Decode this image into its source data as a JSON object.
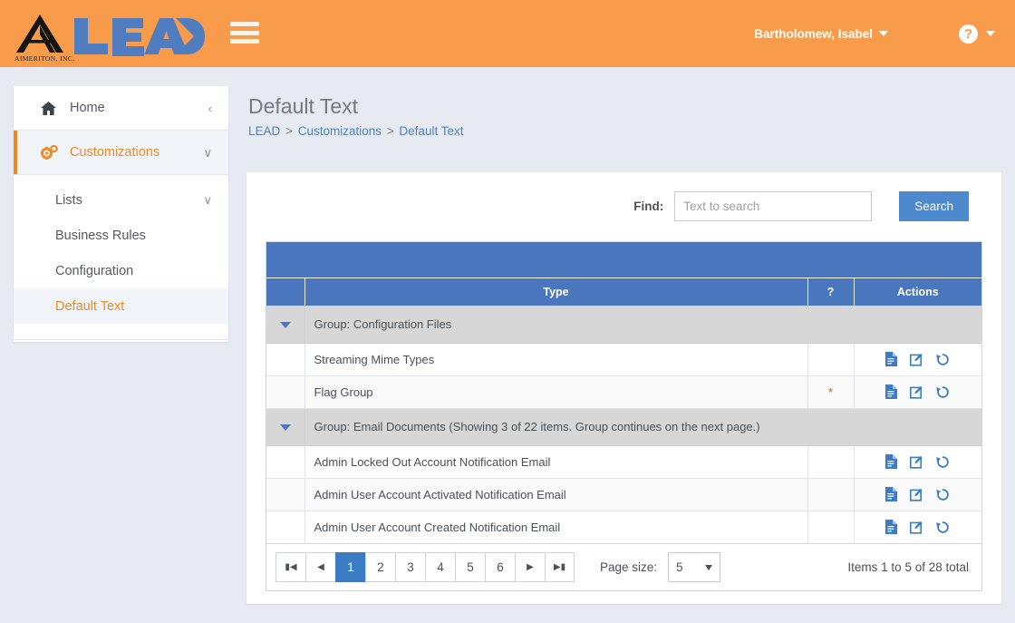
{
  "header": {
    "logo_brand": "LEAD",
    "logo_company": "AIMERITON, INC.",
    "menu_icon": "hamburger-icon",
    "user_name": "Bartholomew, Isabel",
    "help_icon": "question-mark-icon",
    "brand_color": "#f89b4b",
    "accent_blue": "#4a76bd"
  },
  "sidebar": {
    "items": [
      {
        "label": "Home",
        "icon": "home-icon",
        "chevron": "‹",
        "active": false
      },
      {
        "label": "Customizations",
        "icon": "gears-icon",
        "chevron": "∨",
        "active": true
      }
    ],
    "subitems": [
      {
        "label": "Lists",
        "chevron": "∨",
        "selected": false
      },
      {
        "label": "Business Rules",
        "chevron": "",
        "selected": false
      },
      {
        "label": "Configuration",
        "chevron": "",
        "selected": false
      },
      {
        "label": "Default Text",
        "chevron": "",
        "selected": true
      }
    ]
  },
  "page": {
    "title": "Default Text",
    "breadcrumb": [
      {
        "text": "LEAD",
        "link": true
      },
      {
        "text": ">",
        "link": false
      },
      {
        "text": "Customizations",
        "link": true
      },
      {
        "text": ">",
        "link": false
      },
      {
        "text": "Default Text",
        "link": true
      }
    ]
  },
  "search": {
    "find_label": "Find:",
    "placeholder": "Text to search",
    "value": "",
    "button_label": "Search"
  },
  "grid": {
    "columns": [
      {
        "key": "toggle",
        "label": ""
      },
      {
        "key": "type",
        "label": "Type"
      },
      {
        "key": "flag",
        "label": "?"
      },
      {
        "key": "actions",
        "label": "Actions"
      }
    ],
    "action_icons": [
      "file-icon",
      "edit-icon",
      "history-icon"
    ],
    "rows": [
      {
        "kind": "group",
        "label": "Group: Configuration Files",
        "toggle": "triangle-down-icon"
      },
      {
        "kind": "item",
        "type": "Streaming Mime Types",
        "flag": ""
      },
      {
        "kind": "item",
        "type": "Flag Group",
        "flag": "*"
      },
      {
        "kind": "group",
        "label": "Group: Email Documents (Showing 3 of 22 items. Group continues on the next page.)",
        "toggle": "triangle-down-icon"
      },
      {
        "kind": "item",
        "type": "Admin Locked Out Account Notification Email",
        "flag": ""
      },
      {
        "kind": "item",
        "type": "Admin User Account Activated Notification Email",
        "flag": ""
      },
      {
        "kind": "item",
        "type": "Admin User Account Created Notification Email",
        "flag": ""
      }
    ]
  },
  "pager": {
    "buttons": [
      {
        "label": "⏮",
        "name": "first-page-button",
        "active": false
      },
      {
        "label": "◀",
        "name": "prev-page-button",
        "active": false
      },
      {
        "label": "1",
        "name": "page-button-1",
        "active": true
      },
      {
        "label": "2",
        "name": "page-button-2",
        "active": false
      },
      {
        "label": "3",
        "name": "page-button-3",
        "active": false
      },
      {
        "label": "4",
        "name": "page-button-4",
        "active": false
      },
      {
        "label": "5",
        "name": "page-button-5",
        "active": false
      },
      {
        "label": "6",
        "name": "page-button-6",
        "active": false
      },
      {
        "label": "▶",
        "name": "next-page-button",
        "active": false
      },
      {
        "label": "⏭",
        "name": "last-page-button",
        "active": false
      }
    ],
    "page_size_label": "Page size:",
    "page_size_value": "5",
    "items_total": "Items 1 to 5 of 28 total"
  }
}
